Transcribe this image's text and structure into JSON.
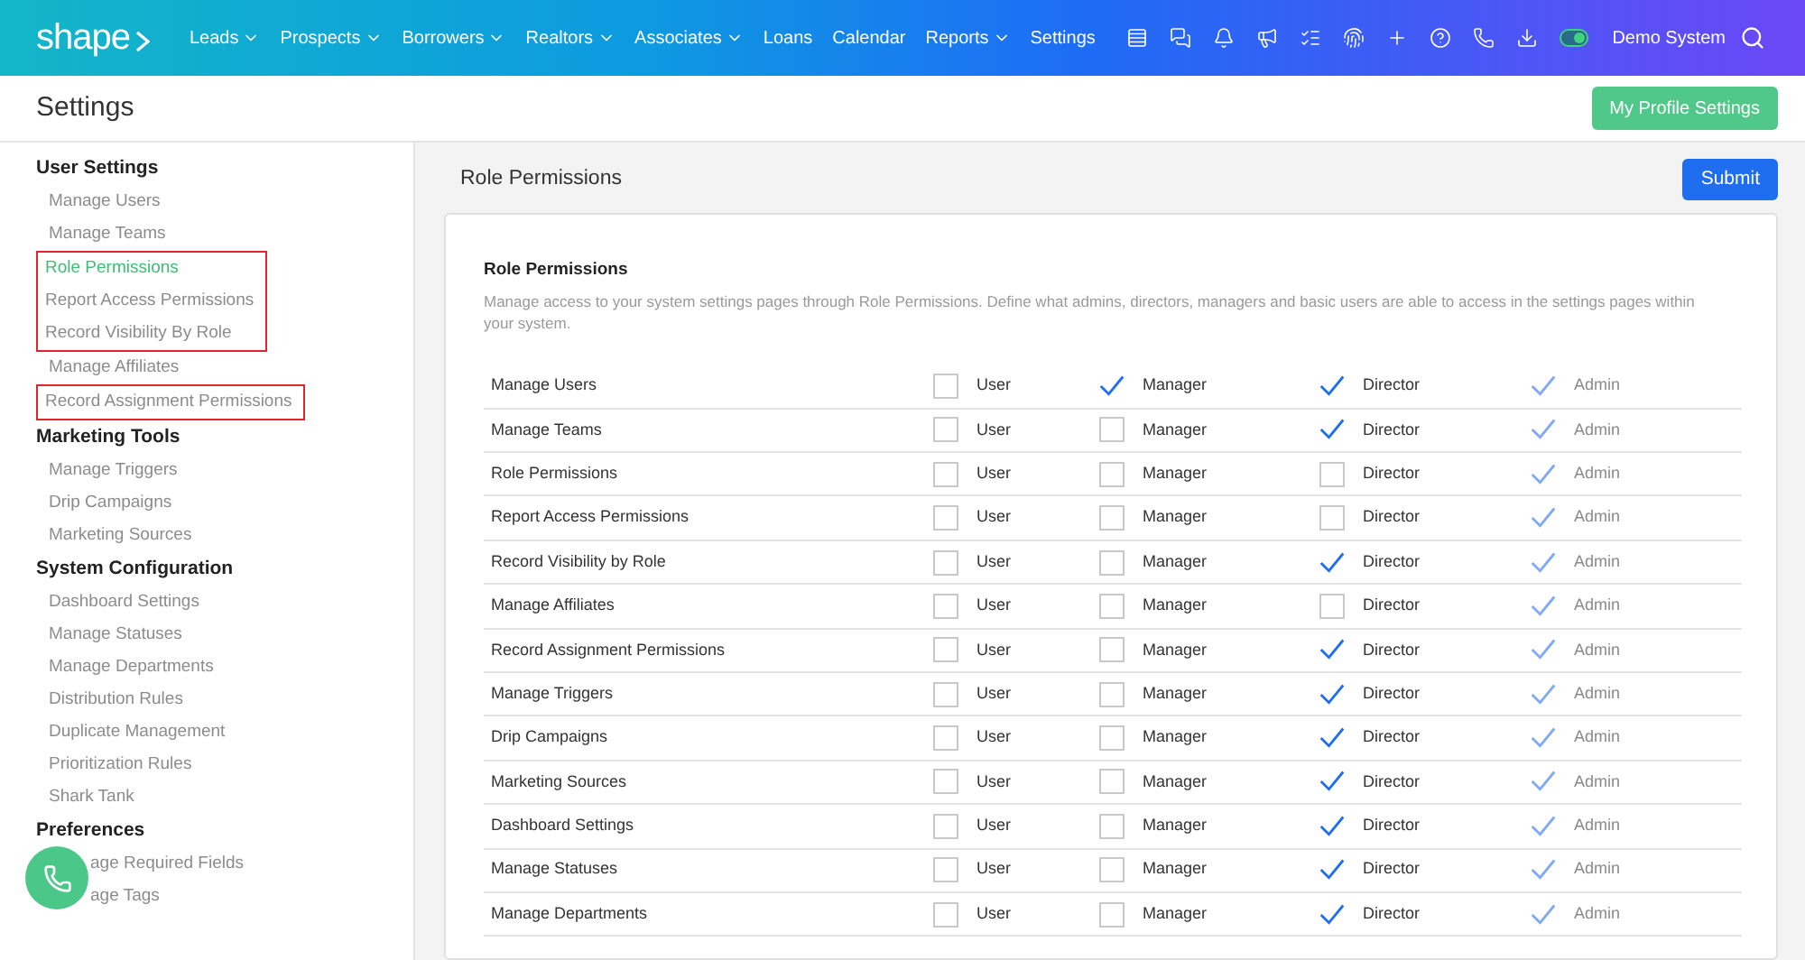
{
  "header": {
    "logo": "shape",
    "nav": [
      {
        "label": "Leads",
        "dropdown": true
      },
      {
        "label": "Prospects",
        "dropdown": true
      },
      {
        "label": "Borrowers",
        "dropdown": true
      },
      {
        "label": "Realtors",
        "dropdown": true
      },
      {
        "label": "Associates",
        "dropdown": true
      },
      {
        "label": "Loans",
        "dropdown": false
      },
      {
        "label": "Calendar",
        "dropdown": false
      },
      {
        "label": "Reports",
        "dropdown": true
      },
      {
        "label": "Settings",
        "dropdown": false
      }
    ],
    "toggle": {
      "on": true
    },
    "account": "Demo System"
  },
  "page_title": "Settings",
  "profile_button": "My Profile Settings",
  "sidebar": [
    {
      "title": "User Settings",
      "items": [
        {
          "kind": "item",
          "label": "Manage Users",
          "selected": false
        },
        {
          "kind": "item",
          "label": "Manage Teams",
          "selected": false
        },
        {
          "kind": "boxed",
          "items": [
            {
              "label": "Role Permissions",
              "selected": true
            },
            {
              "label": "Report Access Permissions",
              "selected": false
            },
            {
              "label": "Record Visibility By Role",
              "selected": false
            }
          ]
        },
        {
          "kind": "item",
          "label": "Manage Affiliates",
          "selected": false
        },
        {
          "kind": "boxed",
          "items": [
            {
              "label": "Record Assignment Permissions",
              "selected": false
            }
          ]
        }
      ]
    },
    {
      "title": "Marketing Tools",
      "items": [
        {
          "kind": "item",
          "label": "Manage Triggers",
          "selected": false
        },
        {
          "kind": "item",
          "label": "Drip Campaigns",
          "selected": false
        },
        {
          "kind": "item",
          "label": "Marketing Sources",
          "selected": false
        }
      ]
    },
    {
      "title": "System Configuration",
      "items": [
        {
          "kind": "item",
          "label": "Dashboard Settings",
          "selected": false
        },
        {
          "kind": "item",
          "label": "Manage Statuses",
          "selected": false
        },
        {
          "kind": "item",
          "label": "Manage Departments",
          "selected": false
        },
        {
          "kind": "item",
          "label": "Distribution Rules",
          "selected": false
        },
        {
          "kind": "item",
          "label": "Duplicate Management",
          "selected": false
        },
        {
          "kind": "item",
          "label": "Prioritization Rules",
          "selected": false
        },
        {
          "kind": "item",
          "label": "Shark Tank",
          "selected": false
        }
      ]
    },
    {
      "title": "Preferences",
      "items": [
        {
          "kind": "covered",
          "label": "age Required Fields",
          "selected": false
        },
        {
          "kind": "covered",
          "label": "age Tags",
          "selected": false
        }
      ]
    }
  ],
  "main": {
    "title": "Role Permissions",
    "submit": "Submit",
    "card_title": "Role Permissions",
    "description": "Manage access to your system settings pages through Role Permissions. Define what admins, directors, managers and basic users are able to access in the settings pages within your system.",
    "rows": [
      {
        "name": "Manage Users",
        "roles": [
          {
            "label": "User",
            "checked": false,
            "disabled": false
          },
          {
            "label": "Manager",
            "checked": true,
            "disabled": false
          },
          {
            "label": "Director",
            "checked": true,
            "disabled": false
          },
          {
            "label": "Admin",
            "checked": true,
            "disabled": true
          }
        ]
      },
      {
        "name": "Manage Teams",
        "roles": [
          {
            "label": "User",
            "checked": false,
            "disabled": false
          },
          {
            "label": "Manager",
            "checked": false,
            "disabled": false
          },
          {
            "label": "Director",
            "checked": true,
            "disabled": false
          },
          {
            "label": "Admin",
            "checked": true,
            "disabled": true
          }
        ]
      },
      {
        "name": "Role Permissions",
        "roles": [
          {
            "label": "User",
            "checked": false,
            "disabled": false
          },
          {
            "label": "Manager",
            "checked": false,
            "disabled": false
          },
          {
            "label": "Director",
            "checked": false,
            "disabled": false
          },
          {
            "label": "Admin",
            "checked": true,
            "disabled": true
          }
        ]
      },
      {
        "name": "Report Access Permissions",
        "roles": [
          {
            "label": "User",
            "checked": false,
            "disabled": false
          },
          {
            "label": "Manager",
            "checked": false,
            "disabled": false
          },
          {
            "label": "Director",
            "checked": false,
            "disabled": false
          },
          {
            "label": "Admin",
            "checked": true,
            "disabled": true
          }
        ]
      },
      {
        "name": "Record Visibility by Role",
        "roles": [
          {
            "label": "User",
            "checked": false,
            "disabled": false
          },
          {
            "label": "Manager",
            "checked": false,
            "disabled": false
          },
          {
            "label": "Director",
            "checked": true,
            "disabled": false
          },
          {
            "label": "Admin",
            "checked": true,
            "disabled": true
          }
        ]
      },
      {
        "name": "Manage Affiliates",
        "roles": [
          {
            "label": "User",
            "checked": false,
            "disabled": false
          },
          {
            "label": "Manager",
            "checked": false,
            "disabled": false
          },
          {
            "label": "Director",
            "checked": false,
            "disabled": false
          },
          {
            "label": "Admin",
            "checked": true,
            "disabled": true
          }
        ]
      },
      {
        "name": "Record Assignment Permissions",
        "roles": [
          {
            "label": "User",
            "checked": false,
            "disabled": false
          },
          {
            "label": "Manager",
            "checked": false,
            "disabled": false
          },
          {
            "label": "Director",
            "checked": true,
            "disabled": false
          },
          {
            "label": "Admin",
            "checked": true,
            "disabled": true
          }
        ]
      },
      {
        "name": "Manage Triggers",
        "roles": [
          {
            "label": "User",
            "checked": false,
            "disabled": false
          },
          {
            "label": "Manager",
            "checked": false,
            "disabled": false
          },
          {
            "label": "Director",
            "checked": true,
            "disabled": false
          },
          {
            "label": "Admin",
            "checked": true,
            "disabled": true
          }
        ]
      },
      {
        "name": "Drip Campaigns",
        "roles": [
          {
            "label": "User",
            "checked": false,
            "disabled": false
          },
          {
            "label": "Manager",
            "checked": false,
            "disabled": false
          },
          {
            "label": "Director",
            "checked": true,
            "disabled": false
          },
          {
            "label": "Admin",
            "checked": true,
            "disabled": true
          }
        ]
      },
      {
        "name": "Marketing Sources",
        "roles": [
          {
            "label": "User",
            "checked": false,
            "disabled": false
          },
          {
            "label": "Manager",
            "checked": false,
            "disabled": false
          },
          {
            "label": "Director",
            "checked": true,
            "disabled": false
          },
          {
            "label": "Admin",
            "checked": true,
            "disabled": true
          }
        ]
      },
      {
        "name": "Dashboard Settings",
        "roles": [
          {
            "label": "User",
            "checked": false,
            "disabled": false
          },
          {
            "label": "Manager",
            "checked": false,
            "disabled": false
          },
          {
            "label": "Director",
            "checked": true,
            "disabled": false
          },
          {
            "label": "Admin",
            "checked": true,
            "disabled": true
          }
        ]
      },
      {
        "name": "Manage Statuses",
        "roles": [
          {
            "label": "User",
            "checked": false,
            "disabled": false
          },
          {
            "label": "Manager",
            "checked": false,
            "disabled": false
          },
          {
            "label": "Director",
            "checked": true,
            "disabled": false
          },
          {
            "label": "Admin",
            "checked": true,
            "disabled": true
          }
        ]
      },
      {
        "name": "Manage Departments",
        "roles": [
          {
            "label": "User",
            "checked": false,
            "disabled": false
          },
          {
            "label": "Manager",
            "checked": false,
            "disabled": false
          },
          {
            "label": "Director",
            "checked": true,
            "disabled": false
          },
          {
            "label": "Admin",
            "checked": true,
            "disabled": true
          }
        ]
      }
    ]
  }
}
